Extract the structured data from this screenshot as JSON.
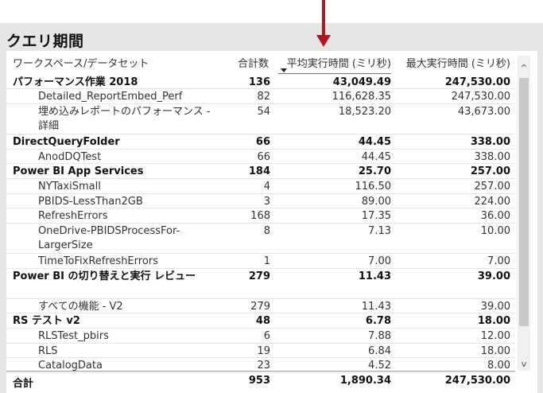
{
  "title": "クエリ期間",
  "headers": {
    "name": "ワークスペース/データセット",
    "count": "合計数",
    "avg": "平均実行時間 (ミリ秒)",
    "max": "最大実行時間 (ミリ秒)"
  },
  "rows": [
    {
      "type": "group",
      "name": "パフォーマンス作業 2018",
      "count": "136",
      "avg": "43,049.49",
      "max": "247,530.00"
    },
    {
      "type": "child",
      "name": "Detailed_ReportEmbed_Perf",
      "count": "82",
      "avg": "116,628.35",
      "max": "247,530.00"
    },
    {
      "type": "child",
      "name": "埋め込みレポートのパフォーマンス - 詳細",
      "count": "54",
      "avg": "18,523.20",
      "max": "43,673.00"
    },
    {
      "type": "group",
      "name": "DirectQueryFolder",
      "count": "66",
      "avg": "44.45",
      "max": "338.00"
    },
    {
      "type": "child",
      "name": "AnodDQTest",
      "count": "66",
      "avg": "44.45",
      "max": "338.00"
    },
    {
      "type": "group",
      "name": "Power BI App Services",
      "count": "184",
      "avg": "25.70",
      "max": "257.00"
    },
    {
      "type": "child",
      "name": "NYTaxiSmall",
      "count": "4",
      "avg": "116.50",
      "max": "257.00"
    },
    {
      "type": "child",
      "name": "PBIDS-LessThan2GB",
      "count": "3",
      "avg": "89.00",
      "max": "224.00"
    },
    {
      "type": "child",
      "name": "RefreshErrors",
      "count": "168",
      "avg": "17.35",
      "max": "36.00"
    },
    {
      "type": "child",
      "name": "OneDrive-PBIDSProcessFor-LargerSize",
      "count": "8",
      "avg": "7.13",
      "max": "10.00"
    },
    {
      "type": "child",
      "name": "TimeToFixRefreshErrors",
      "count": "1",
      "avg": "7.00",
      "max": "7.00"
    },
    {
      "type": "group",
      "name": "Power BI の切り替えと実行 レビュー",
      "count": "279",
      "avg": "11.43",
      "max": "39.00"
    },
    {
      "type": "child",
      "name": "すべての機能 - V2",
      "count": "279",
      "avg": "11.43",
      "max": "39.00"
    },
    {
      "type": "group",
      "name": "RS テスト v2",
      "count": "48",
      "avg": "6.78",
      "max": "18.00"
    },
    {
      "type": "child",
      "name": "RLSTest_pbirs",
      "count": "6",
      "avg": "7.88",
      "max": "12.00"
    },
    {
      "type": "child",
      "name": "RLS",
      "count": "19",
      "avg": "6.84",
      "max": "18.00"
    },
    {
      "type": "child",
      "name": "CatalogData",
      "count": "23",
      "avg": "4.52",
      "max": "8.00"
    }
  ],
  "total": {
    "name": "合計",
    "count": "953",
    "avg": "1,890.34",
    "max": "247,530.00"
  },
  "scrollbar": {
    "up_icon": "chevron-up-icon",
    "down_icon": "chevron-down-icon",
    "up_glyph": "^",
    "down_glyph": "v"
  },
  "colors": {
    "arrow": "#b0171f",
    "frame": "#e6e6e6"
  }
}
